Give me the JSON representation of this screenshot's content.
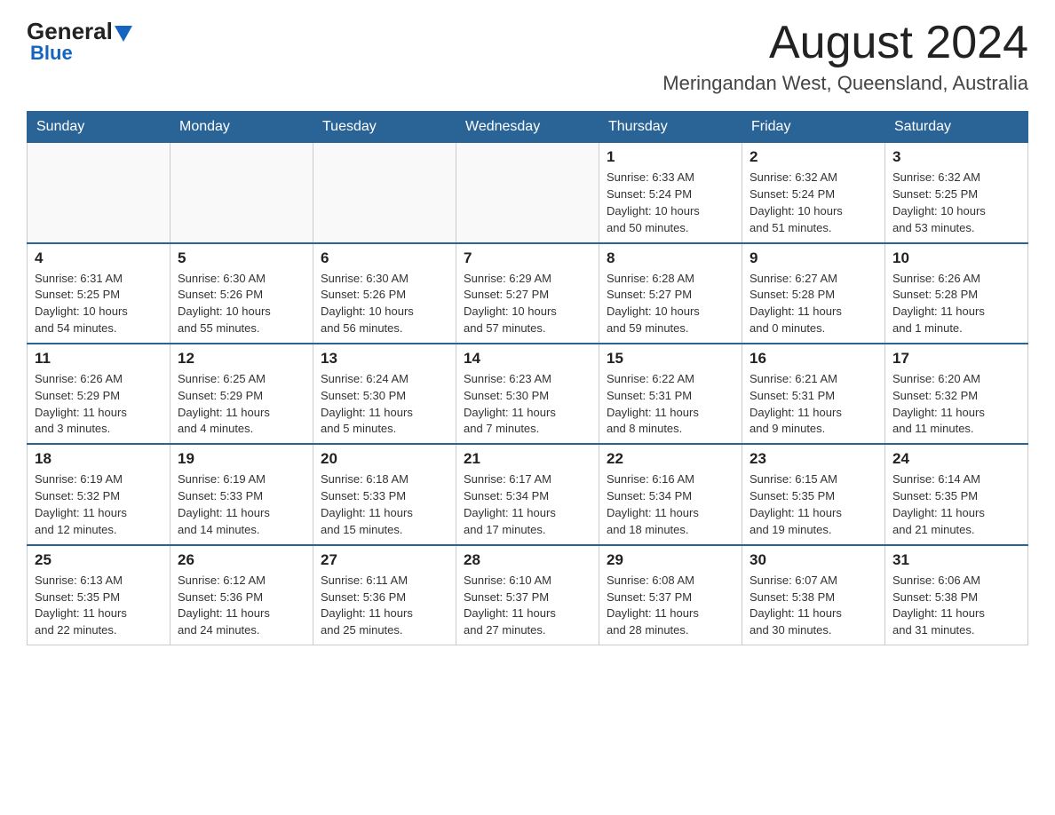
{
  "logo": {
    "general": "General",
    "blue": "Blue",
    "sub": "Blue"
  },
  "header": {
    "month": "August 2024",
    "location": "Meringandan West, Queensland, Australia"
  },
  "days_of_week": [
    "Sunday",
    "Monday",
    "Tuesday",
    "Wednesday",
    "Thursday",
    "Friday",
    "Saturday"
  ],
  "weeks": [
    [
      {
        "day": "",
        "info": ""
      },
      {
        "day": "",
        "info": ""
      },
      {
        "day": "",
        "info": ""
      },
      {
        "day": "",
        "info": ""
      },
      {
        "day": "1",
        "info": "Sunrise: 6:33 AM\nSunset: 5:24 PM\nDaylight: 10 hours\nand 50 minutes."
      },
      {
        "day": "2",
        "info": "Sunrise: 6:32 AM\nSunset: 5:24 PM\nDaylight: 10 hours\nand 51 minutes."
      },
      {
        "day": "3",
        "info": "Sunrise: 6:32 AM\nSunset: 5:25 PM\nDaylight: 10 hours\nand 53 minutes."
      }
    ],
    [
      {
        "day": "4",
        "info": "Sunrise: 6:31 AM\nSunset: 5:25 PM\nDaylight: 10 hours\nand 54 minutes."
      },
      {
        "day": "5",
        "info": "Sunrise: 6:30 AM\nSunset: 5:26 PM\nDaylight: 10 hours\nand 55 minutes."
      },
      {
        "day": "6",
        "info": "Sunrise: 6:30 AM\nSunset: 5:26 PM\nDaylight: 10 hours\nand 56 minutes."
      },
      {
        "day": "7",
        "info": "Sunrise: 6:29 AM\nSunset: 5:27 PM\nDaylight: 10 hours\nand 57 minutes."
      },
      {
        "day": "8",
        "info": "Sunrise: 6:28 AM\nSunset: 5:27 PM\nDaylight: 10 hours\nand 59 minutes."
      },
      {
        "day": "9",
        "info": "Sunrise: 6:27 AM\nSunset: 5:28 PM\nDaylight: 11 hours\nand 0 minutes."
      },
      {
        "day": "10",
        "info": "Sunrise: 6:26 AM\nSunset: 5:28 PM\nDaylight: 11 hours\nand 1 minute."
      }
    ],
    [
      {
        "day": "11",
        "info": "Sunrise: 6:26 AM\nSunset: 5:29 PM\nDaylight: 11 hours\nand 3 minutes."
      },
      {
        "day": "12",
        "info": "Sunrise: 6:25 AM\nSunset: 5:29 PM\nDaylight: 11 hours\nand 4 minutes."
      },
      {
        "day": "13",
        "info": "Sunrise: 6:24 AM\nSunset: 5:30 PM\nDaylight: 11 hours\nand 5 minutes."
      },
      {
        "day": "14",
        "info": "Sunrise: 6:23 AM\nSunset: 5:30 PM\nDaylight: 11 hours\nand 7 minutes."
      },
      {
        "day": "15",
        "info": "Sunrise: 6:22 AM\nSunset: 5:31 PM\nDaylight: 11 hours\nand 8 minutes."
      },
      {
        "day": "16",
        "info": "Sunrise: 6:21 AM\nSunset: 5:31 PM\nDaylight: 11 hours\nand 9 minutes."
      },
      {
        "day": "17",
        "info": "Sunrise: 6:20 AM\nSunset: 5:32 PM\nDaylight: 11 hours\nand 11 minutes."
      }
    ],
    [
      {
        "day": "18",
        "info": "Sunrise: 6:19 AM\nSunset: 5:32 PM\nDaylight: 11 hours\nand 12 minutes."
      },
      {
        "day": "19",
        "info": "Sunrise: 6:19 AM\nSunset: 5:33 PM\nDaylight: 11 hours\nand 14 minutes."
      },
      {
        "day": "20",
        "info": "Sunrise: 6:18 AM\nSunset: 5:33 PM\nDaylight: 11 hours\nand 15 minutes."
      },
      {
        "day": "21",
        "info": "Sunrise: 6:17 AM\nSunset: 5:34 PM\nDaylight: 11 hours\nand 17 minutes."
      },
      {
        "day": "22",
        "info": "Sunrise: 6:16 AM\nSunset: 5:34 PM\nDaylight: 11 hours\nand 18 minutes."
      },
      {
        "day": "23",
        "info": "Sunrise: 6:15 AM\nSunset: 5:35 PM\nDaylight: 11 hours\nand 19 minutes."
      },
      {
        "day": "24",
        "info": "Sunrise: 6:14 AM\nSunset: 5:35 PM\nDaylight: 11 hours\nand 21 minutes."
      }
    ],
    [
      {
        "day": "25",
        "info": "Sunrise: 6:13 AM\nSunset: 5:35 PM\nDaylight: 11 hours\nand 22 minutes."
      },
      {
        "day": "26",
        "info": "Sunrise: 6:12 AM\nSunset: 5:36 PM\nDaylight: 11 hours\nand 24 minutes."
      },
      {
        "day": "27",
        "info": "Sunrise: 6:11 AM\nSunset: 5:36 PM\nDaylight: 11 hours\nand 25 minutes."
      },
      {
        "day": "28",
        "info": "Sunrise: 6:10 AM\nSunset: 5:37 PM\nDaylight: 11 hours\nand 27 minutes."
      },
      {
        "day": "29",
        "info": "Sunrise: 6:08 AM\nSunset: 5:37 PM\nDaylight: 11 hours\nand 28 minutes."
      },
      {
        "day": "30",
        "info": "Sunrise: 6:07 AM\nSunset: 5:38 PM\nDaylight: 11 hours\nand 30 minutes."
      },
      {
        "day": "31",
        "info": "Sunrise: 6:06 AM\nSunset: 5:38 PM\nDaylight: 11 hours\nand 31 minutes."
      }
    ]
  ]
}
